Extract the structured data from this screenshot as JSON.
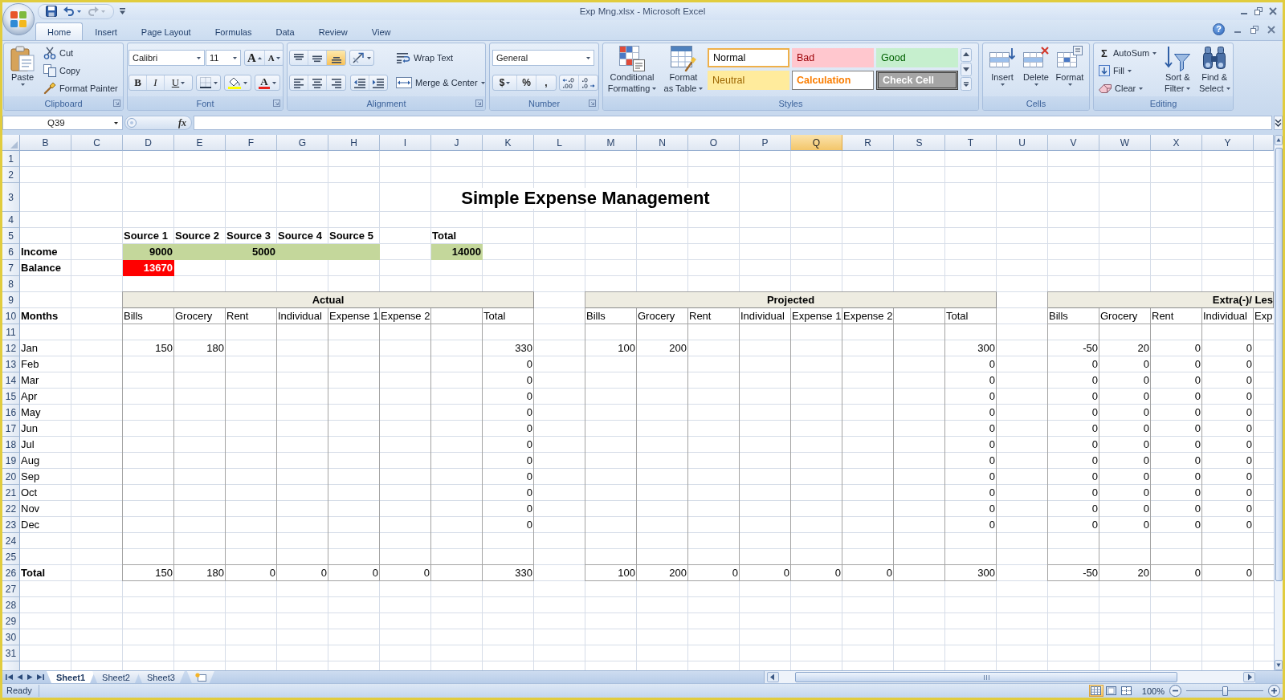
{
  "window": {
    "title": "Exp Mng.xlsx - Microsoft Excel"
  },
  "quick_access": [
    {
      "kind": "save",
      "disabled": false
    },
    {
      "kind": "undo",
      "disabled": false
    },
    {
      "kind": "redo",
      "disabled": true
    },
    {
      "kind": "customize",
      "disabled": false
    }
  ],
  "ribbon": {
    "tabs": [
      {
        "label": "Home",
        "selected": true
      },
      {
        "label": "Insert",
        "selected": false
      },
      {
        "label": "Page Layout",
        "selected": false
      },
      {
        "label": "Formulas",
        "selected": false
      },
      {
        "label": "Data",
        "selected": false
      },
      {
        "label": "Review",
        "selected": false
      },
      {
        "label": "View",
        "selected": false
      }
    ],
    "help": "?",
    "clipboard": {
      "label": "Clipboard",
      "paste": "Paste",
      "actions": [
        {
          "kind": "cut",
          "label": "Cut"
        },
        {
          "kind": "copy",
          "label": "Copy"
        },
        {
          "kind": "format_painter",
          "label": "Format Painter"
        }
      ]
    },
    "font": {
      "label": "Font",
      "name": "Calibri",
      "size": "11",
      "grow": "A",
      "shrink": "A",
      "styles": [
        {
          "kind": "bold",
          "text": "B"
        },
        {
          "kind": "italic",
          "text": "I"
        },
        {
          "kind": "underline",
          "text": "U"
        }
      ],
      "font_color": "A"
    },
    "alignment": {
      "label": "Alignment",
      "vertical": [
        {
          "kind": "top",
          "selected": false
        },
        {
          "kind": "middle",
          "selected": false
        },
        {
          "kind": "bottom",
          "selected": true
        }
      ],
      "horizontal": [
        {
          "kind": "left",
          "selected": false
        },
        {
          "kind": "center",
          "selected": false
        },
        {
          "kind": "right",
          "selected": false
        }
      ],
      "wrap_text": "Wrap Text",
      "merge": "Merge & Center"
    },
    "number": {
      "label": "Number",
      "format": "General",
      "symbols": [
        {
          "kind": "currency",
          "text": "$"
        },
        {
          "kind": "percent",
          "text": "%"
        },
        {
          "kind": "comma",
          "text": ","
        }
      ]
    },
    "styles": {
      "label": "Styles",
      "commands": [
        {
          "kind": "conditional",
          "lines": [
            "Conditional",
            "Formatting"
          ]
        },
        {
          "kind": "table",
          "lines": [
            "Format",
            "as Table"
          ]
        }
      ],
      "gallery": [
        {
          "kind": "normal",
          "label": "Normal",
          "selected": true
        },
        {
          "kind": "bad",
          "label": "Bad",
          "selected": false
        },
        {
          "kind": "good",
          "label": "Good",
          "selected": false
        },
        {
          "kind": "neutral",
          "label": "Neutral",
          "selected": false
        },
        {
          "kind": "calculation",
          "label": "Calculation",
          "selected": false
        },
        {
          "kind": "check",
          "label": "Check Cell",
          "selected": false
        }
      ]
    },
    "cells": {
      "label": "Cells",
      "commands": [
        {
          "kind": "insert",
          "label": "Insert"
        },
        {
          "kind": "delete",
          "label": "Delete"
        },
        {
          "kind": "format",
          "label": "Format"
        }
      ]
    },
    "editing": {
      "label": "Editing",
      "commands": [
        {
          "kind": "autosum",
          "glyph": "Σ",
          "label": "AutoSum"
        },
        {
          "kind": "fill",
          "label": "Fill"
        },
        {
          "kind": "clear",
          "label": "Clear"
        }
      ],
      "tools": [
        {
          "kind": "sort",
          "lines": [
            "Sort &",
            "Filter"
          ]
        },
        {
          "kind": "find",
          "lines": [
            "Find &",
            "Select"
          ]
        }
      ]
    }
  },
  "formula_bar": {
    "name_box": "Q39",
    "function_label": "fx"
  },
  "sheet": {
    "columns": [
      {
        "label": "B",
        "selected": false
      },
      {
        "label": "C",
        "selected": false
      },
      {
        "label": "D",
        "selected": false
      },
      {
        "label": "E",
        "selected": false
      },
      {
        "label": "F",
        "selected": false
      },
      {
        "label": "G",
        "selected": false
      },
      {
        "label": "H",
        "selected": false
      },
      {
        "label": "I",
        "selected": false
      },
      {
        "label": "J",
        "selected": false
      },
      {
        "label": "K",
        "selected": false
      },
      {
        "label": "L",
        "selected": false
      },
      {
        "label": "M",
        "selected": false
      },
      {
        "label": "N",
        "selected": false
      },
      {
        "label": "O",
        "selected": false
      },
      {
        "label": "P",
        "selected": false
      },
      {
        "label": "Q",
        "selected": true
      },
      {
        "label": "R",
        "selected": false
      },
      {
        "label": "S",
        "selected": false
      },
      {
        "label": "T",
        "selected": false
      },
      {
        "label": "U",
        "selected": false
      },
      {
        "label": "V",
        "selected": false
      },
      {
        "label": "W",
        "selected": false
      },
      {
        "label": "X",
        "selected": false
      },
      {
        "label": "Y",
        "selected": false
      }
    ],
    "rows": [
      "1",
      "2",
      "3",
      "4",
      "5",
      "6",
      "7",
      "8",
      "9",
      "10",
      "11",
      "12",
      "13",
      "14",
      "15",
      "16",
      "17",
      "18",
      "19",
      "20",
      "21",
      "22",
      "23",
      "24",
      "25",
      "26",
      "27",
      "28",
      "29",
      "30",
      "31"
    ],
    "title": "Simple Expense Management",
    "income": {
      "label": "Income",
      "sources": [
        {
          "heading": "Source 1",
          "amount": "9000"
        },
        {
          "heading": "Source 2"
        },
        {
          "heading": "Source 3",
          "amount": "5000"
        },
        {
          "heading": "Source 4"
        },
        {
          "heading": "Source 5"
        }
      ],
      "total_heading": "Total",
      "total": "14000"
    },
    "balance": {
      "label": "Balance",
      "amount": "13670",
      "highlighted": true
    },
    "months": {
      "heading": "Months",
      "items": [
        "Jan",
        "Feb",
        "Mar",
        "Apr",
        "May",
        "Jun",
        "Jul",
        "Aug",
        "Sep",
        "Oct",
        "Nov",
        "Dec"
      ],
      "total_label": "Total"
    },
    "tables": [
      {
        "title": "Actual",
        "headings": [
          "Bills",
          "Grocery",
          "Rent",
          "Individual",
          "Expense 1",
          "Expense 2"
        ],
        "total_heading": "Total",
        "rows": [
          {
            "amounts": [
              "150",
              "180"
            ],
            "total": "330"
          },
          {
            "total": "0"
          },
          {
            "total": "0"
          },
          {
            "total": "0"
          },
          {
            "total": "0"
          },
          {
            "total": "0"
          },
          {
            "total": "0"
          },
          {
            "total": "0"
          },
          {
            "total": "0"
          },
          {
            "total": "0"
          },
          {
            "total": "0"
          },
          {
            "total": "0"
          }
        ],
        "totals": {
          "amounts": [
            "150",
            "180",
            "0",
            "0",
            "0",
            "0"
          ],
          "total": "330"
        }
      },
      {
        "title": "Projected",
        "headings": [
          "Bills",
          "Grocery",
          "Rent",
          "Individual",
          "Expense 1",
          "Expense 2"
        ],
        "total_heading": "Total",
        "rows": [
          {
            "amounts": [
              "100",
              "200"
            ],
            "total": "300"
          },
          {
            "total": "0"
          },
          {
            "total": "0"
          },
          {
            "total": "0"
          },
          {
            "total": "0"
          },
          {
            "total": "0"
          },
          {
            "total": "0"
          },
          {
            "total": "0"
          },
          {
            "total": "0"
          },
          {
            "total": "0"
          },
          {
            "total": "0"
          },
          {
            "total": "0"
          }
        ],
        "totals": {
          "amounts": [
            "100",
            "200",
            "0",
            "0",
            "0",
            "0"
          ],
          "total": "300"
        }
      },
      {
        "title": "Extra(-)/ Les",
        "headings": [
          "Bills",
          "Grocery",
          "Rent",
          "Individual",
          "Exp"
        ],
        "rows": [
          {
            "amounts": [
              "-50",
              "20",
              "0",
              "0"
            ]
          },
          {
            "amounts": [
              "0",
              "0",
              "0",
              "0"
            ]
          },
          {
            "amounts": [
              "0",
              "0",
              "0",
              "0"
            ]
          },
          {
            "amounts": [
              "0",
              "0",
              "0",
              "0"
            ]
          },
          {
            "amounts": [
              "0",
              "0",
              "0",
              "0"
            ]
          },
          {
            "amounts": [
              "0",
              "0",
              "0",
              "0"
            ]
          },
          {
            "amounts": [
              "0",
              "0",
              "0",
              "0"
            ]
          },
          {
            "amounts": [
              "0",
              "0",
              "0",
              "0"
            ]
          },
          {
            "amounts": [
              "0",
              "0",
              "0",
              "0"
            ]
          },
          {
            "amounts": [
              "0",
              "0",
              "0",
              "0"
            ]
          },
          {
            "amounts": [
              "0",
              "0",
              "0",
              "0"
            ]
          },
          {
            "amounts": [
              "0",
              "0",
              "0",
              "0"
            ]
          }
        ],
        "totals": {
          "amounts": [
            "-50",
            "20",
            "0",
            "0"
          ]
        }
      }
    ]
  },
  "sheet_tabs": [
    {
      "label": "Sheet1",
      "selected": true
    },
    {
      "label": "Sheet2",
      "selected": false
    },
    {
      "label": "Sheet3",
      "selected": false
    }
  ],
  "status_bar": {
    "text": "Ready",
    "views": [
      {
        "kind": "normal",
        "selected": true
      },
      {
        "kind": "page_layout",
        "selected": false
      },
      {
        "kind": "page_break",
        "selected": false
      }
    ],
    "zoom": {
      "label": "100%",
      "level": 0.5
    }
  }
}
